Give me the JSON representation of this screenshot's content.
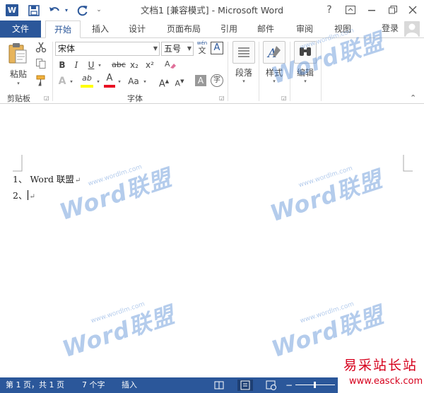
{
  "titlebar": {
    "app_badge": "W",
    "title": "文档1 [兼容模式] - Microsoft Word",
    "help": "?",
    "dropdown_glyph": "▾"
  },
  "tabs": {
    "file": "文件",
    "items": [
      "开始",
      "插入",
      "设计",
      "页面布局",
      "引用",
      "邮件",
      "审阅",
      "视图"
    ],
    "active": "开始",
    "login": "登录"
  },
  "ribbon": {
    "clipboard": {
      "paste_label": "粘贴",
      "group_label": "剪贴板"
    },
    "font": {
      "font_name": "宋体",
      "font_size": "五号",
      "phonetic": "wén",
      "phonetic_char": "文",
      "border_char": "A",
      "bold": "B",
      "italic": "I",
      "underline": "U",
      "strike": "abc",
      "sub": "x₂",
      "sup": "x²",
      "effect": "A",
      "highlight": "ab",
      "font_color": "A",
      "change_case": "Aa",
      "grow": "A",
      "shrink": "A",
      "shade": "A",
      "enclose": "字",
      "group_label": "字体"
    },
    "paragraph": {
      "label": "段落"
    },
    "styles": {
      "label": "样式"
    },
    "editing": {
      "label": "编辑"
    }
  },
  "document": {
    "lines": [
      {
        "number": "1、",
        "text": "Word 联盟"
      },
      {
        "number": "2、",
        "text": ""
      }
    ],
    "para_mark": "↵"
  },
  "watermarks": {
    "big": "Word联盟",
    "small": "www.wordlm.com"
  },
  "statusbar": {
    "page": "第 1 页，共 1 页",
    "words": "7 个字",
    "mode": "插入"
  },
  "site_badge": {
    "name": "易采站长站",
    "url": "www.easck.com"
  },
  "colors": {
    "accent": "#2b579a",
    "highlight": "#ffff00",
    "font_color": "#e81123",
    "badge_red": "#d6001c"
  }
}
